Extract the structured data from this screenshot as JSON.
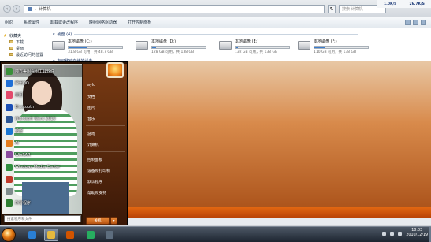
{
  "explorer": {
    "address": "计算机",
    "search_placeholder": "搜索 计算机",
    "tray_stats": [
      "1.0K/S",
      "26.7K/S"
    ],
    "toolbar": [
      "组织",
      "系统属性",
      "卸载或更改程序",
      "映射网络驱动器",
      "打开控制面板"
    ],
    "sidebar": [
      "收藏夹",
      "下载",
      "桌面",
      "最近访问的位置"
    ],
    "group_disks": "硬盘 (4)",
    "group_removable": "有可移动存储的设备",
    "drives": [
      {
        "name": "本地磁盘 (C:)",
        "info": "31.8 GB 可用，共 48.7 GB",
        "used_fraction": 0.35
      },
      {
        "name": "本地磁盘 (D:)",
        "info": "128 GB 可用，共 138 GB",
        "used_fraction": 0.07
      },
      {
        "name": "本地磁盘 (E:)",
        "info": "132 GB 可用，共 138 GB",
        "used_fraction": 0.04
      },
      {
        "name": "本地磁盘 (F:)",
        "info": "110 GB 可用，共 138 GB",
        "used_fraction": 0.2
      }
    ]
  },
  "startmenu": {
    "programs": [
      {
        "label": "魔方美图看图工具软件",
        "color": "#3a8f3a"
      },
      {
        "label": "腾讯QQ",
        "color": "#1f6fd6"
      },
      {
        "label": "美图",
        "color": "#e34a6b"
      },
      {
        "label": "Bluetooth",
        "color": "#1a4fb5"
      },
      {
        "label": "Microsoft Word 2010",
        "color": "#2b5797"
      },
      {
        "label": "迅雷",
        "color": "#1976d2"
      },
      {
        "label": "AI",
        "color": "#e37b1c"
      },
      {
        "label": "WinRAR",
        "color": "#8b4c9e"
      },
      {
        "label": "Windows Media Center",
        "color": "#2f8f3f"
      },
      {
        "label": "",
        "color": "#c0392b"
      },
      {
        "label": "",
        "color": "#7f8c8d"
      },
      {
        "label": "所有程序",
        "color": "#2e7d32"
      }
    ],
    "search_placeholder": "搜索程序和文件",
    "right_items": [
      "aylu",
      "文档",
      "图片",
      "音乐",
      "游戏",
      "计算机",
      "控制面板",
      "设备和打印机",
      "默认程序",
      "帮助和支持"
    ],
    "shutdown": "关机"
  },
  "taskbar": {
    "clock_time": "18:03",
    "clock_date": "2010/12/19",
    "apps": [
      {
        "name": "ie",
        "color": "#2a7fd4"
      },
      {
        "name": "explorer",
        "color": "#e6b93e"
      },
      {
        "name": "media",
        "color": "#d35400"
      },
      {
        "name": "360",
        "color": "#27ae60"
      },
      {
        "name": "control",
        "color": "#5d6d7e"
      }
    ]
  }
}
